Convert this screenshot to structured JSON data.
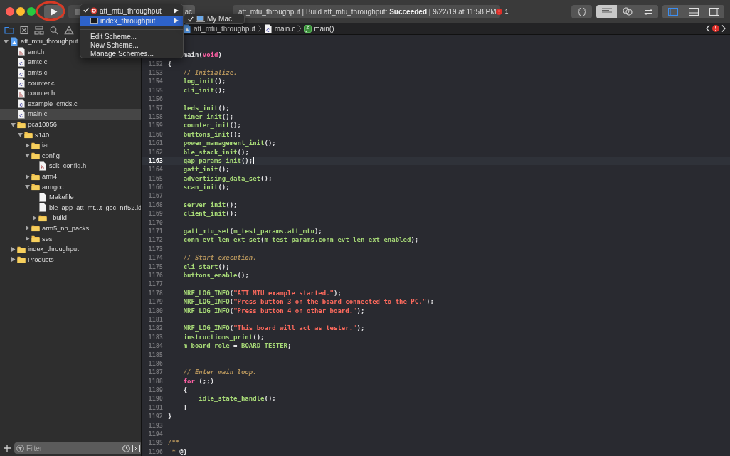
{
  "toolbar": {
    "play_button": {
      "annotated": true
    },
    "scheme_button": {
      "label": "ac"
    },
    "activity": {
      "text": "att_mtu_throughput | Build att_mtu_throughput: **Succeeded** | 9/22/19 at 11:58 PM",
      "errors": "1"
    },
    "editor_modes": [
      {
        "kind": "standard",
        "selected": true
      },
      {
        "kind": "assistant",
        "selected": false
      },
      {
        "kind": "version",
        "selected": false
      }
    ],
    "panels": [
      {
        "kind": "navigator",
        "on": true
      },
      {
        "kind": "debug",
        "on": false
      },
      {
        "kind": "inspector",
        "on": false
      }
    ]
  },
  "scheme_menu": {
    "items": [
      {
        "kind": "target",
        "label": "att_mtu_throughput",
        "checked": true,
        "selected": false
      },
      {
        "kind": "app",
        "label": "index_throughput",
        "checked": false,
        "selected": true
      }
    ],
    "actions": [
      "Edit Scheme...",
      "New Scheme...",
      "Manage Schemes..."
    ],
    "submenu": {
      "label": "My Mac",
      "checked": true
    }
  },
  "navigator": {
    "tabs": [
      {
        "kind": "project",
        "selected": true
      },
      {
        "kind": "source",
        "selected": false
      },
      {
        "kind": "symbols",
        "selected": false
      },
      {
        "kind": "search",
        "selected": false
      },
      {
        "kind": "issues",
        "selected": false
      }
    ],
    "tree": [
      {
        "kind": "project",
        "label": "att_mtu_throughput",
        "expanded": true,
        "selected": false,
        "children": [
          {
            "kind": "h",
            "label": "amt.h",
            "selected": false
          },
          {
            "kind": "c",
            "label": "amtc.c",
            "selected": false
          },
          {
            "kind": "c",
            "label": "amts.c",
            "selected": false
          },
          {
            "kind": "c",
            "label": "counter.c",
            "selected": false
          },
          {
            "kind": "h",
            "label": "counter.h",
            "selected": false
          },
          {
            "kind": "c",
            "label": "example_cmds.c",
            "selected": false
          },
          {
            "kind": "c",
            "label": "main.c",
            "selected": true
          },
          {
            "kind": "folder",
            "label": "pca10056",
            "expanded": true,
            "selected": false,
            "children": [
              {
                "kind": "folder",
                "label": "s140",
                "expanded": true,
                "selected": false,
                "children": [
                  {
                    "kind": "folder",
                    "label": "iar",
                    "expanded": false,
                    "selected": false
                  },
                  {
                    "kind": "folder",
                    "label": "config",
                    "expanded": true,
                    "selected": false,
                    "children": [
                      {
                        "kind": "h",
                        "label": "sdk_config.h",
                        "selected": false
                      }
                    ]
                  },
                  {
                    "kind": "folder",
                    "label": "arm4",
                    "expanded": false,
                    "selected": false
                  },
                  {
                    "kind": "folder",
                    "label": "armgcc",
                    "expanded": true,
                    "selected": false,
                    "children": [
                      {
                        "kind": "file",
                        "label": "Makefile",
                        "selected": false
                      },
                      {
                        "kind": "file",
                        "label": "ble_app_att_mt...t_gcc_nrf52.ld",
                        "selected": false
                      },
                      {
                        "kind": "folder",
                        "label": "_build",
                        "expanded": false,
                        "selected": false
                      }
                    ]
                  },
                  {
                    "kind": "folder",
                    "label": "arm5_no_packs",
                    "expanded": false,
                    "selected": false
                  },
                  {
                    "kind": "folder",
                    "label": "ses",
                    "expanded": false,
                    "selected": false
                  }
                ]
              }
            ]
          },
          {
            "kind": "folder",
            "label": "index_throughput",
            "expanded": false,
            "selected": false
          },
          {
            "kind": "folder",
            "label": "Products",
            "expanded": false,
            "selected": false
          }
        ]
      }
    ],
    "filter": {
      "placeholder": "Filter"
    }
  },
  "jump_bar": {
    "path": [
      {
        "kind": "project",
        "label": "att_mtu_throughput"
      },
      {
        "kind": "c",
        "label": "main.c"
      },
      {
        "kind": "function",
        "label": "main()"
      }
    ]
  },
  "editor": {
    "lines": [
      {
        "current": false,
        "tokens": [
          {
            "kind": "plain",
            "text": "    main("
          },
          {
            "kind": "keyword",
            "text": "void"
          },
          {
            "kind": "plain",
            "text": ")"
          }
        ]
      },
      {
        "number": "1152",
        "current": false,
        "tokens": [
          {
            "kind": "plain",
            "text": "{"
          }
        ]
      },
      {
        "number": "1153",
        "current": false,
        "tokens": [
          {
            "kind": "comment",
            "text": "    // Initialize."
          }
        ]
      },
      {
        "number": "1154",
        "current": false,
        "tokens": [
          {
            "kind": "function",
            "text": "    log_init"
          },
          {
            "kind": "plain",
            "text": "();"
          }
        ]
      },
      {
        "number": "1155",
        "current": false,
        "tokens": [
          {
            "kind": "function",
            "text": "    cli_init"
          },
          {
            "kind": "plain",
            "text": "();"
          }
        ]
      },
      {
        "number": "1156",
        "current": false
      },
      {
        "number": "1157",
        "current": false,
        "tokens": [
          {
            "kind": "function",
            "text": "    leds_init"
          },
          {
            "kind": "plain",
            "text": "();"
          }
        ]
      },
      {
        "number": "1158",
        "current": false,
        "tokens": [
          {
            "kind": "function",
            "text": "    timer_init"
          },
          {
            "kind": "plain",
            "text": "();"
          }
        ]
      },
      {
        "number": "1159",
        "current": false,
        "tokens": [
          {
            "kind": "function",
            "text": "    counter_init"
          },
          {
            "kind": "plain",
            "text": "();"
          }
        ]
      },
      {
        "number": "1160",
        "current": false,
        "tokens": [
          {
            "kind": "function",
            "text": "    buttons_init"
          },
          {
            "kind": "plain",
            "text": "();"
          }
        ]
      },
      {
        "number": "1161",
        "current": false,
        "tokens": [
          {
            "kind": "function",
            "text": "    power_management_init"
          },
          {
            "kind": "plain",
            "text": "();"
          }
        ]
      },
      {
        "number": "1162",
        "current": false,
        "tokens": [
          {
            "kind": "function",
            "text": "    ble_stack_init"
          },
          {
            "kind": "plain",
            "text": "();"
          }
        ]
      },
      {
        "number": "1163",
        "current": true,
        "tokens": [
          {
            "kind": "function",
            "text": "    gap_params_init"
          },
          {
            "kind": "plain",
            "text": "();"
          }
        ]
      },
      {
        "number": "1164",
        "current": false,
        "tokens": [
          {
            "kind": "function",
            "text": "    gatt_init"
          },
          {
            "kind": "plain",
            "text": "();"
          }
        ]
      },
      {
        "number": "1165",
        "current": false,
        "tokens": [
          {
            "kind": "function",
            "text": "    advertising_data_set"
          },
          {
            "kind": "plain",
            "text": "();"
          }
        ]
      },
      {
        "number": "1166",
        "current": false,
        "tokens": [
          {
            "kind": "function",
            "text": "    scan_init"
          },
          {
            "kind": "plain",
            "text": "();"
          }
        ]
      },
      {
        "number": "1167",
        "current": false
      },
      {
        "number": "1168",
        "current": false,
        "tokens": [
          {
            "kind": "function",
            "text": "    server_init"
          },
          {
            "kind": "plain",
            "text": "();"
          }
        ]
      },
      {
        "number": "1169",
        "current": false,
        "tokens": [
          {
            "kind": "function",
            "text": "    client_init"
          },
          {
            "kind": "plain",
            "text": "();"
          }
        ]
      },
      {
        "number": "1170",
        "current": false
      },
      {
        "number": "1171",
        "current": false,
        "tokens": [
          {
            "kind": "function",
            "text": "    gatt_mtu_set"
          },
          {
            "kind": "plain",
            "text": "("
          },
          {
            "kind": "function",
            "text": "m_test_params.att_mtu"
          },
          {
            "kind": "plain",
            "text": ");"
          }
        ]
      },
      {
        "number": "1172",
        "current": false,
        "tokens": [
          {
            "kind": "function",
            "text": "    conn_evt_len_ext_set"
          },
          {
            "kind": "plain",
            "text": "("
          },
          {
            "kind": "function",
            "text": "m_test_params.conn_evt_len_ext_enabled"
          },
          {
            "kind": "plain",
            "text": ");"
          }
        ]
      },
      {
        "number": "1173",
        "current": false
      },
      {
        "number": "1174",
        "current": false,
        "tokens": [
          {
            "kind": "comment",
            "text": "    // Start execution."
          }
        ]
      },
      {
        "number": "1175",
        "current": false,
        "tokens": [
          {
            "kind": "function",
            "text": "    cli_start"
          },
          {
            "kind": "plain",
            "text": "();"
          }
        ]
      },
      {
        "number": "1176",
        "current": false,
        "tokens": [
          {
            "kind": "function",
            "text": "    buttons_enable"
          },
          {
            "kind": "plain",
            "text": "();"
          }
        ]
      },
      {
        "number": "1177",
        "current": false
      },
      {
        "number": "1178",
        "current": false,
        "tokens": [
          {
            "kind": "function",
            "text": "    NRF_LOG_INFO"
          },
          {
            "kind": "plain",
            "text": "("
          },
          {
            "kind": "string",
            "text": "\"ATT MTU example started.\""
          },
          {
            "kind": "plain",
            "text": ");"
          }
        ]
      },
      {
        "number": "1179",
        "current": false,
        "tokens": [
          {
            "kind": "function",
            "text": "    NRF_LOG_INFO"
          },
          {
            "kind": "plain",
            "text": "("
          },
          {
            "kind": "string",
            "text": "\"Press button 3 on the board connected to the PC.\""
          },
          {
            "kind": "plain",
            "text": ");"
          }
        ]
      },
      {
        "number": "1180",
        "current": false,
        "tokens": [
          {
            "kind": "function",
            "text": "    NRF_LOG_INFO"
          },
          {
            "kind": "plain",
            "text": "("
          },
          {
            "kind": "string",
            "text": "\"Press button 4 on other board.\""
          },
          {
            "kind": "plain",
            "text": ");"
          }
        ]
      },
      {
        "number": "1181",
        "current": false
      },
      {
        "number": "1182",
        "current": false,
        "tokens": [
          {
            "kind": "function",
            "text": "    NRF_LOG_INFO"
          },
          {
            "kind": "plain",
            "text": "("
          },
          {
            "kind": "string",
            "text": "\"This board will act as tester.\""
          },
          {
            "kind": "plain",
            "text": ");"
          }
        ]
      },
      {
        "number": "1183",
        "current": false,
        "tokens": [
          {
            "kind": "function",
            "text": "    instructions_print"
          },
          {
            "kind": "plain",
            "text": "();"
          }
        ]
      },
      {
        "number": "1184",
        "current": false,
        "tokens": [
          {
            "kind": "function",
            "text": "    m_board_role"
          },
          {
            "kind": "plain",
            "text": " = "
          },
          {
            "kind": "function",
            "text": "BOARD_TESTER"
          },
          {
            "kind": "plain",
            "text": ";"
          }
        ]
      },
      {
        "number": "1185",
        "current": false
      },
      {
        "number": "1186",
        "current": false
      },
      {
        "number": "1187",
        "current": false,
        "tokens": [
          {
            "kind": "comment",
            "text": "    // Enter main loop."
          }
        ]
      },
      {
        "number": "1188",
        "current": false,
        "tokens": [
          {
            "kind": "keyword",
            "text": "    for"
          },
          {
            "kind": "plain",
            "text": " (;;)"
          }
        ]
      },
      {
        "number": "1189",
        "current": false,
        "tokens": [
          {
            "kind": "plain",
            "text": "    {"
          }
        ]
      },
      {
        "number": "1190",
        "current": false,
        "tokens": [
          {
            "kind": "function",
            "text": "        idle_state_handle"
          },
          {
            "kind": "plain",
            "text": "();"
          }
        ]
      },
      {
        "number": "1191",
        "current": false,
        "tokens": [
          {
            "kind": "plain",
            "text": "    }"
          }
        ]
      },
      {
        "number": "1192",
        "current": false,
        "tokens": [
          {
            "kind": "plain",
            "text": "}"
          }
        ]
      },
      {
        "number": "1193",
        "current": false
      },
      {
        "number": "1194",
        "current": false
      },
      {
        "number": "1195",
        "current": false,
        "tokens": [
          {
            "kind": "comment",
            "text": "/**"
          }
        ]
      },
      {
        "number": "1196",
        "current": false,
        "tokens": [
          {
            "kind": "comment",
            "text": " * "
          },
          {
            "kind": "plain",
            "text": "@}"
          }
        ]
      }
    ]
  }
}
